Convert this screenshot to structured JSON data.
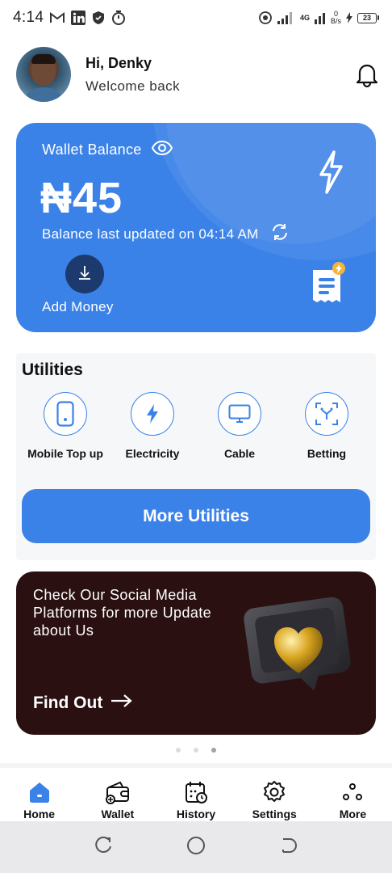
{
  "status_bar": {
    "time": "4:14",
    "network": "4G",
    "speed_value": "0",
    "speed_unit": "B/s",
    "battery": "23"
  },
  "header": {
    "greeting": "Hi, Denky",
    "subtitle": "Welcome back"
  },
  "wallet": {
    "title": "Wallet Balance",
    "amount": "₦45",
    "updated": "Balance last updated on 04:14 AM",
    "add_money_label": "Add Money"
  },
  "utilities": {
    "title": "Utilities",
    "items": [
      {
        "label": "Mobile Top up",
        "icon": "phone-icon"
      },
      {
        "label": "Electricity",
        "icon": "lightning-icon"
      },
      {
        "label": "Cable",
        "icon": "monitor-icon"
      },
      {
        "label": "Betting",
        "icon": "betting-icon"
      }
    ],
    "more_label": "More Utilities"
  },
  "promo": {
    "text": "Check Our Social Media Platforms for more Update about Us",
    "cta": "Find Out"
  },
  "carousel": {
    "count": 3,
    "active": 3
  },
  "bottom_nav": {
    "items": [
      {
        "label": "Home",
        "icon": "home-icon",
        "active": true
      },
      {
        "label": "Wallet",
        "icon": "wallet-icon",
        "active": false
      },
      {
        "label": "History",
        "icon": "history-icon",
        "active": false
      },
      {
        "label": "Settings",
        "icon": "gear-icon",
        "active": false
      },
      {
        "label": "More",
        "icon": "more-icon",
        "active": false
      }
    ]
  },
  "colors": {
    "primary": "#3b82e8",
    "add_money_button": "#1c3a6e",
    "promo_bg": "#2a1010",
    "badge": "#f4b63a"
  }
}
